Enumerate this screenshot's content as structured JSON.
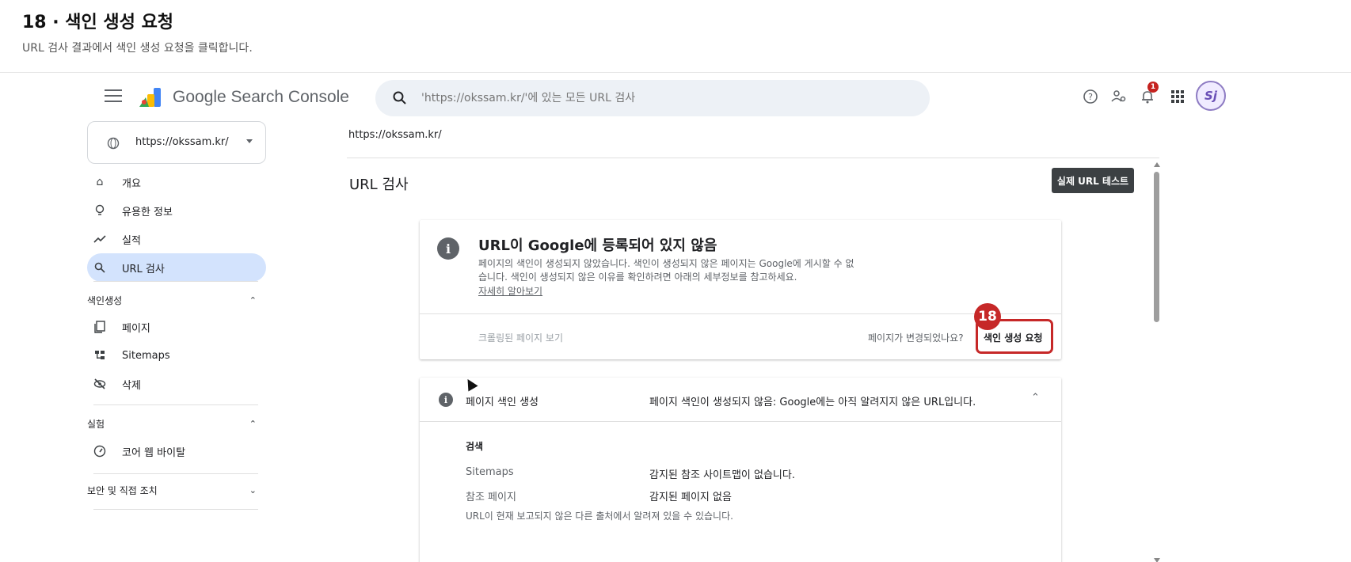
{
  "tutorial": {
    "title": "18 · 색인 생성 요청",
    "description": "URL 검사 결과에서 색인 생성 요청을 클릭합니다."
  },
  "app": {
    "brand": "Google Search Console",
    "search_placeholder": "'https://okssam.kr/'에 있는 모든 URL 검사",
    "notification_count": "1",
    "avatar_text": "Sj",
    "colors": {
      "accent": "#d3e3fd",
      "highlight": "#c62828"
    }
  },
  "sidebar": {
    "property": "https://okssam.kr/",
    "items": [
      {
        "label": "개요",
        "icon": "home-icon"
      },
      {
        "label": "유용한 정보",
        "icon": "lightbulb-icon"
      },
      {
        "label": "실적",
        "icon": "trending-up-icon"
      },
      {
        "label": "URL 검사",
        "icon": "search-icon",
        "active": true
      }
    ],
    "sections": [
      {
        "label": "색인생성",
        "items": [
          {
            "label": "페이지",
            "icon": "pages-icon"
          },
          {
            "label": "Sitemaps",
            "icon": "sitemap-icon"
          },
          {
            "label": "삭제",
            "icon": "visibility-off-icon"
          }
        ]
      },
      {
        "label": "실험",
        "items": [
          {
            "label": "코어 웹 바이탈",
            "icon": "speed-icon"
          }
        ]
      },
      {
        "label": "보안 및 직접 조치",
        "items": []
      }
    ]
  },
  "main": {
    "breadcrumb": "https://okssam.kr/",
    "title": "URL 검사",
    "live_test": "실제 URL 테스트",
    "status_card": {
      "title": "URL이 Google에 등록되어 있지 않음",
      "desc_line1": "페이지의 색인이 생성되지 않았습니다. 색인이 생성되지 않은 페이지는 Google에 게시할 수 없",
      "desc_line2": "습니다. 색인이 생성되지 않은 이유를 확인하려면 아래의 세부정보를 참고하세요.",
      "learn_more": "자세히 알아보기",
      "crawled_page": "크롤링된 페이지 보기",
      "changed_prompt": "페이지가 변경되었나요?",
      "request_indexing": "색인 생성 요청"
    },
    "step_badge": "18",
    "indexing_card": {
      "label": "페이지 색인 생성",
      "status": "페이지 색인이 생성되지 않음: Google에는 아직 알려지지 않은 URL입니다.",
      "section": "검색",
      "rows": [
        {
          "key": "Sitemaps",
          "value": "감지된 참조 사이트맵이 없습니다."
        },
        {
          "key": "참조 페이지",
          "value": "감지된 페이지 없음"
        }
      ],
      "truncated_line": "URL이 현재 보고되지 않은 다른 출처에서 알려져 있을 수 있습니다."
    }
  }
}
